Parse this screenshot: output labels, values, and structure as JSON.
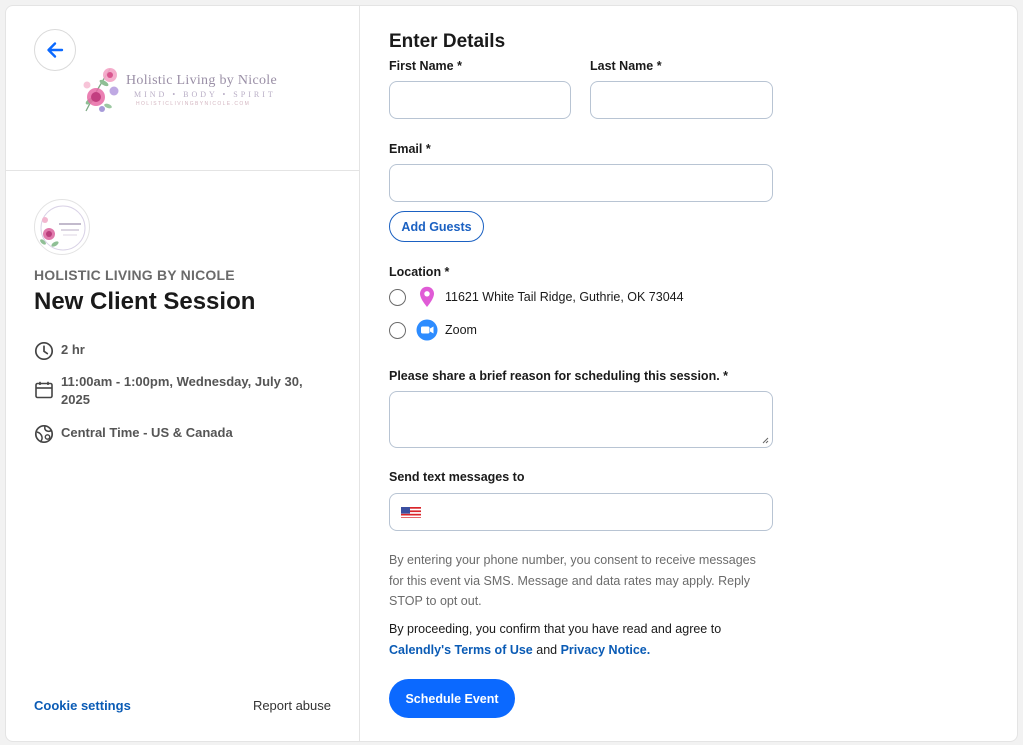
{
  "org": {
    "logo_title": "Holistic Living by Nicole",
    "logo_tagline": "MIND • BODY • SPIRIT",
    "logo_url": "HOLISTICLIVINGBYNICOLE.COM",
    "name": "HOLISTIC LIVING BY NICOLE"
  },
  "event": {
    "title": "New Client Session",
    "duration": "2 hr",
    "datetime": "11:00am - 1:00pm, Wednesday, July 30, 2025",
    "timezone": "Central Time - US & Canada"
  },
  "left_footer": {
    "cookie_settings": "Cookie settings",
    "report_abuse": "Report abuse"
  },
  "form": {
    "title": "Enter Details",
    "first_name_label": "First Name *",
    "first_name_value": "",
    "last_name_label": "Last Name *",
    "last_name_value": "",
    "email_label": "Email *",
    "email_value": "",
    "add_guests": "Add Guests",
    "location_label": "Location *",
    "location_options": [
      {
        "label": "11621 White Tail Ridge, Guthrie, OK 73044",
        "icon": "map-pin-icon",
        "color": "#e05bd6"
      },
      {
        "label": "Zoom",
        "icon": "zoom-video-icon",
        "color": "#2d8cff"
      }
    ],
    "reason_label": "Please share a brief reason for scheduling this session. *",
    "reason_value": "",
    "sms_label": "Send text messages to",
    "phone_country": "US",
    "phone_value": "",
    "consent_text": "By entering your phone number, you consent to receive messages for this event via SMS. Message and data rates may apply. Reply STOP to opt out.",
    "agree_prefix": "By proceeding, you confirm that you have read and agree to",
    "terms_link": "Calendly's Terms of Use",
    "agree_and": "and",
    "privacy_link": "Privacy Notice.",
    "submit": "Schedule Event"
  },
  "colors": {
    "accent": "#0b69ff",
    "link": "#0a5bb5",
    "pin": "#e05bd6",
    "zoom": "#2d8cff"
  }
}
